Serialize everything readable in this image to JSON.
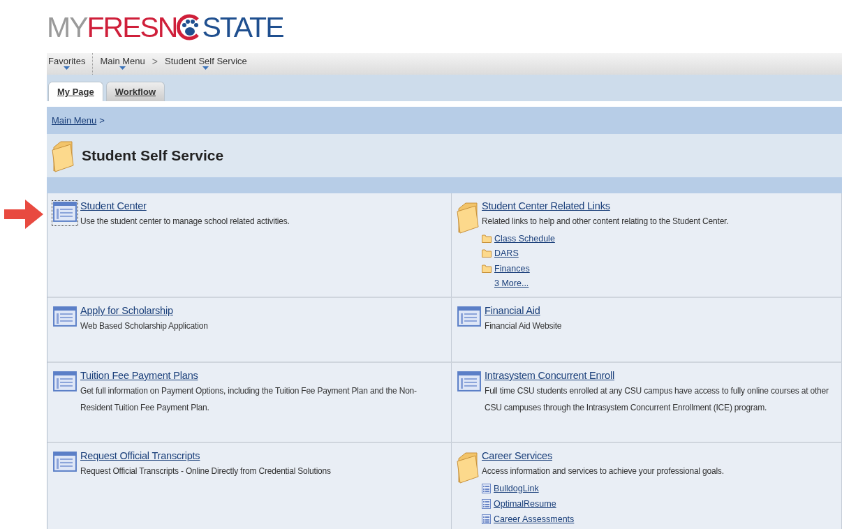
{
  "logo": {
    "my": "MY",
    "fresno": "FRESN",
    "state": "STATE"
  },
  "nav": [
    {
      "label": "Favorites"
    },
    {
      "label": "Main Menu",
      "separator": ">"
    },
    {
      "label": "Student Self Service"
    }
  ],
  "tabs": [
    {
      "label": "My Page",
      "selected": true
    },
    {
      "label": "Workflow",
      "selected": false
    }
  ],
  "breadcrumb": {
    "link": "Main Menu",
    "separator": ">"
  },
  "page_title": "Student Self Service",
  "cells": [
    {
      "kind": "page",
      "title": "Student Center",
      "description": "Use the student center to manage school related activities.",
      "focused": true,
      "pointer": true
    },
    {
      "kind": "folder",
      "title": "Student Center Related Links",
      "description": "Related links to help and other content relating to the Student Center.",
      "links": [
        {
          "label": "Class Schedule",
          "kind": "folder"
        },
        {
          "label": "DARS",
          "kind": "folder"
        },
        {
          "label": "Finances",
          "kind": "folder"
        },
        {
          "label": "3 More...",
          "kind": "more"
        }
      ]
    },
    {
      "kind": "page",
      "title": "Apply for Scholarship",
      "description": "Web Based Scholarship Application"
    },
    {
      "kind": "page",
      "title": "Financial Aid",
      "description": "Financial Aid Website"
    },
    {
      "kind": "page",
      "title": "Tuition Fee Payment Plans",
      "description": "Get full information on Payment Options, including the Tuition Fee Payment Plan and the Non-Resident Tuition Fee Payment Plan."
    },
    {
      "kind": "page",
      "title": "Intrasystem Concurrent Enroll",
      "description": "Full time CSU students enrolled at any CSU campus have access to fully online courses at other CSU campuses through the Intrasystem Concurrent Enrollment (ICE) program."
    },
    {
      "kind": "page",
      "title": "Request Official Transcripts",
      "description": "Request Official Transcripts - Online Directly from Credential Solutions"
    },
    {
      "kind": "folder",
      "title": "Career Services",
      "description": "Access information and services to achieve your professional goals.",
      "links": [
        {
          "label": "BulldogLink",
          "kind": "page"
        },
        {
          "label": "OptimalResume",
          "kind": "page"
        },
        {
          "label": "Career Assessments",
          "kind": "page"
        }
      ]
    }
  ]
}
